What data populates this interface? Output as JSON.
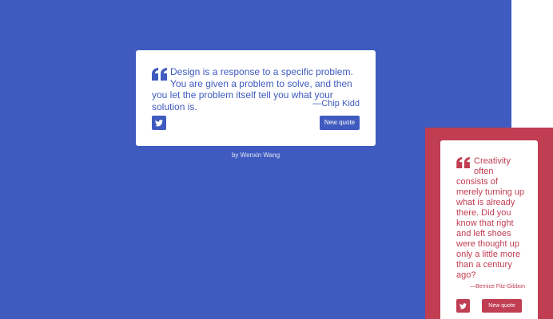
{
  "colors": {
    "blue_theme": "#3f5bbf",
    "red_theme": "#c03d52",
    "card_background": "#ffffff",
    "page_background": "#ffffff"
  },
  "main_quote": {
    "text": "Design is a response to a specific problem. You are given a problem to solve, and then you let the problem itself tell you what your solution is.",
    "author": "—Chip Kidd",
    "tweet_icon": "twitter-icon",
    "new_quote_label": "New quote"
  },
  "footer": {
    "byline": "by Wenxin Wang"
  },
  "secondary_quote": {
    "text": "Creativity often consists of merely turning up what is already there. Did you know that right and left shoes were thought up only a little more than a century ago?",
    "author": "—Bernice Fitz-Gibbon",
    "tweet_icon": "twitter-icon",
    "new_quote_label": "New quote"
  }
}
